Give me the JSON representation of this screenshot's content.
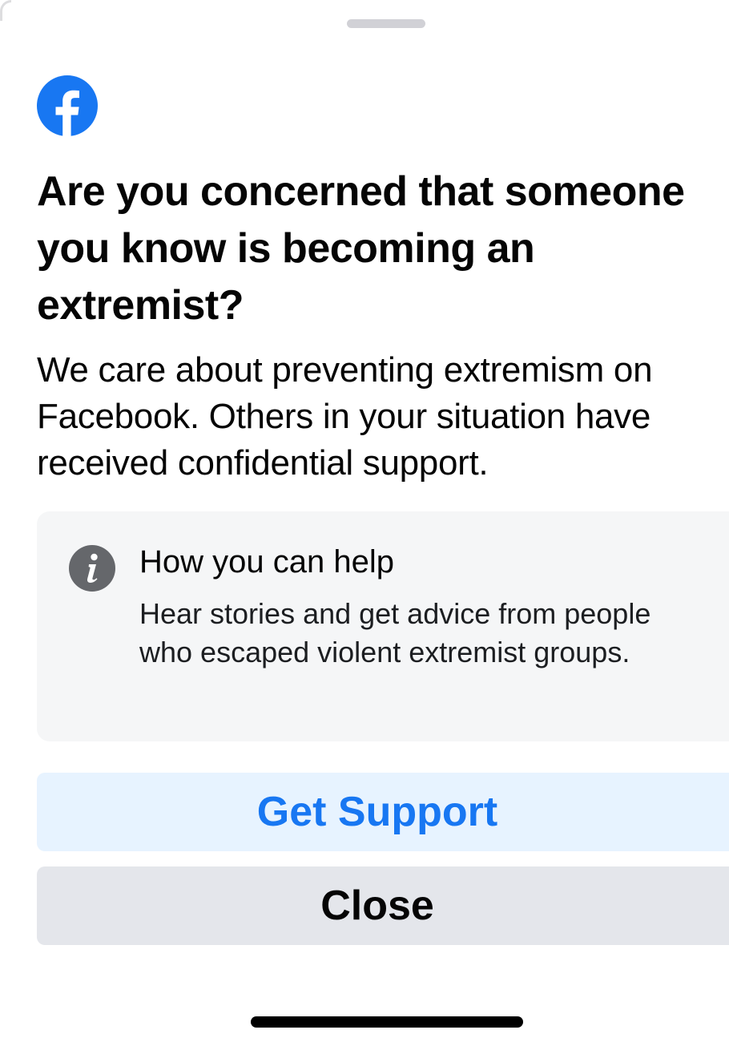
{
  "dialog": {
    "title": "Are you concerned that someone you know is becoming an extremist?",
    "subtitle": "We care about preventing extremism on Facebook. Others in your situation have received confidential support.",
    "logo_icon": "facebook-logo-icon",
    "info_card": {
      "icon": "info-icon",
      "heading": "How you can help",
      "body": "Hear stories and get advice from people who escaped violent extremist groups."
    },
    "buttons": {
      "primary_label": "Get Support",
      "secondary_label": "Close"
    }
  },
  "colors": {
    "brand_blue": "#1877F2",
    "primary_button_bg": "#E7F3FF",
    "secondary_button_bg": "#E4E6EB",
    "card_bg": "#F5F6F7",
    "info_icon": "#65676B"
  }
}
